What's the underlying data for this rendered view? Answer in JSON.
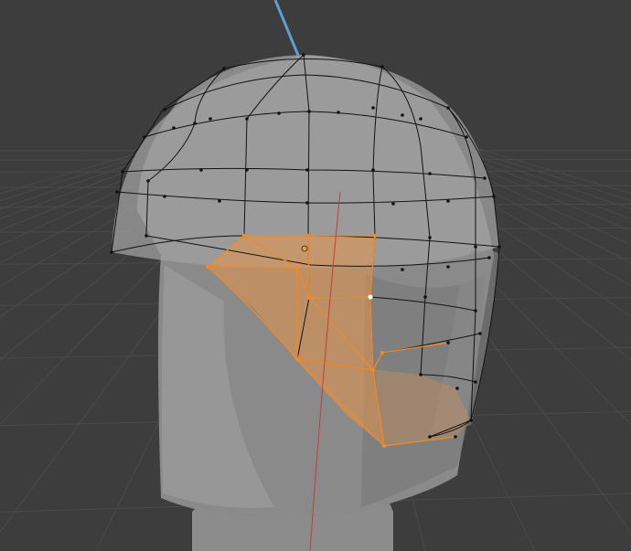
{
  "viewport": {
    "type": "3d-viewport",
    "mode": "edit-mode",
    "colors": {
      "background": "#3d3d3d",
      "grid_line": "#484848",
      "mesh_gray": "#8f8f8f",
      "mesh_shadow": "#6e6e6e",
      "wire": "#111111",
      "selected": "#f08a24",
      "selected_fill": "#e8944a",
      "z_axis": "#5aa0d6",
      "y_axis": "#c83c3c",
      "active_vertex": "#ffffff"
    }
  }
}
